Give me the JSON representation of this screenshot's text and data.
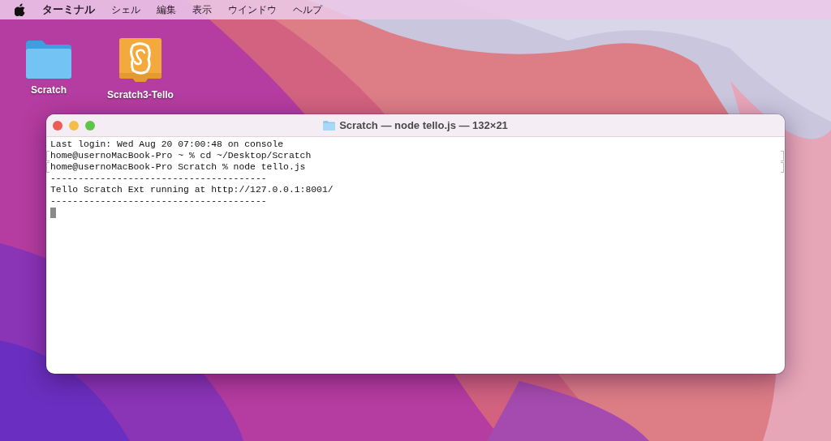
{
  "menu_bar": {
    "items": [
      {
        "label": "ターミナル",
        "kind": "app"
      },
      {
        "label": "シェル",
        "kind": "menu"
      },
      {
        "label": "編集",
        "kind": "menu"
      },
      {
        "label": "表示",
        "kind": "menu"
      },
      {
        "label": "ウインドウ",
        "kind": "menu"
      },
      {
        "label": "ヘルプ",
        "kind": "menu"
      }
    ]
  },
  "desktop_icons": [
    {
      "label": "Scratch",
      "kind": "folder"
    },
    {
      "label": "Scratch3-Tello",
      "kind": "app"
    }
  ],
  "window": {
    "title": "Scratch — node tello.js — 132×21",
    "lines": [
      {
        "text": "Last login: Wed Aug 20 07:00:48 on console",
        "marked": false
      },
      {
        "text": "home@usernoMacBook-Pro ~ % cd ~/Desktop/Scratch",
        "marked": true
      },
      {
        "text": "home@usernoMacBook-Pro Scratch % node tello.js",
        "marked": true
      },
      {
        "text": "---------------------------------------",
        "marked": false
      },
      {
        "text": "Tello Scratch Ext running at http://127.0.0.1:8001/",
        "marked": false
      },
      {
        "text": "---------------------------------------",
        "marked": false
      }
    ],
    "cursor": true
  }
}
